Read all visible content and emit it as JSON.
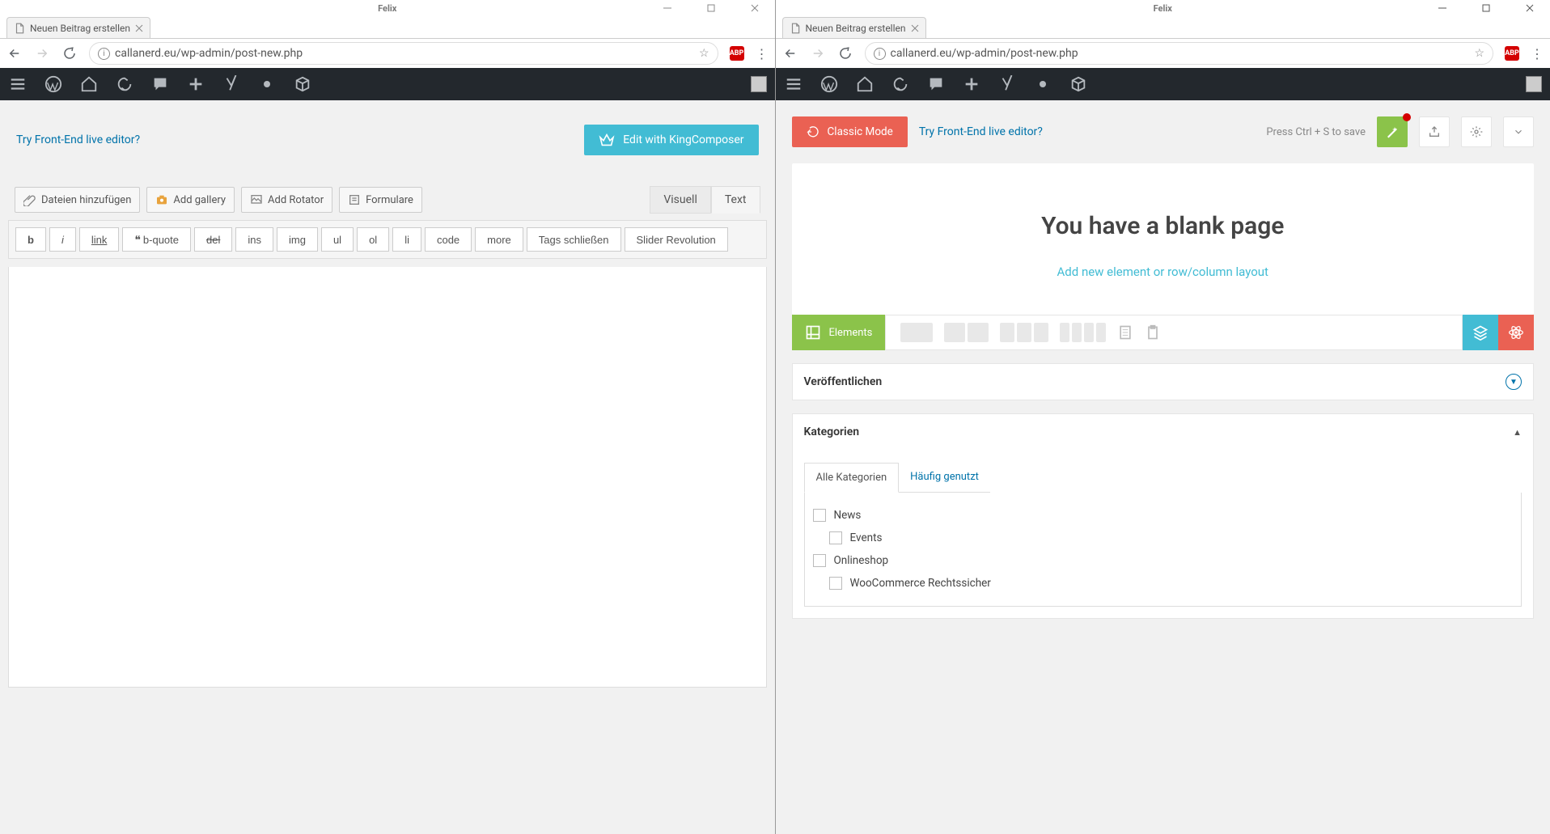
{
  "owner": "Felix",
  "tab_title": "Neuen Beitrag erstellen",
  "url": "callanerd.eu/wp-admin/post-new.php",
  "ext_label": "ABP",
  "left": {
    "try_link": "Try Front-End live editor?",
    "kc_button": "Edit with KingComposer",
    "media": {
      "files": "Dateien hinzufügen",
      "gallery": "Add gallery",
      "rotator": "Add Rotator",
      "forms": "Formulare"
    },
    "ed_tabs": {
      "visual": "Visuell",
      "text": "Text"
    },
    "qt": [
      "b",
      "i",
      "link",
      "b-quote",
      "del",
      "ins",
      "img",
      "ul",
      "ol",
      "li",
      "code",
      "more",
      "Tags schließen",
      "Slider Revolution"
    ]
  },
  "right": {
    "classic": "Classic Mode",
    "try_link": "Try Front-End live editor?",
    "save_hint": "Press Ctrl + S to save",
    "blank_h": "You have a blank page",
    "add_link": "Add new element or row/column layout",
    "elements_label": "Elements",
    "publish": "Veröffentlichen",
    "categories": "Kategorien",
    "cat_tabs": {
      "all": "Alle Kategorien",
      "used": "Häufig genutzt"
    },
    "cats": [
      "News",
      "Events",
      "Onlineshop",
      "WooCommerce Rechtssicher"
    ]
  }
}
